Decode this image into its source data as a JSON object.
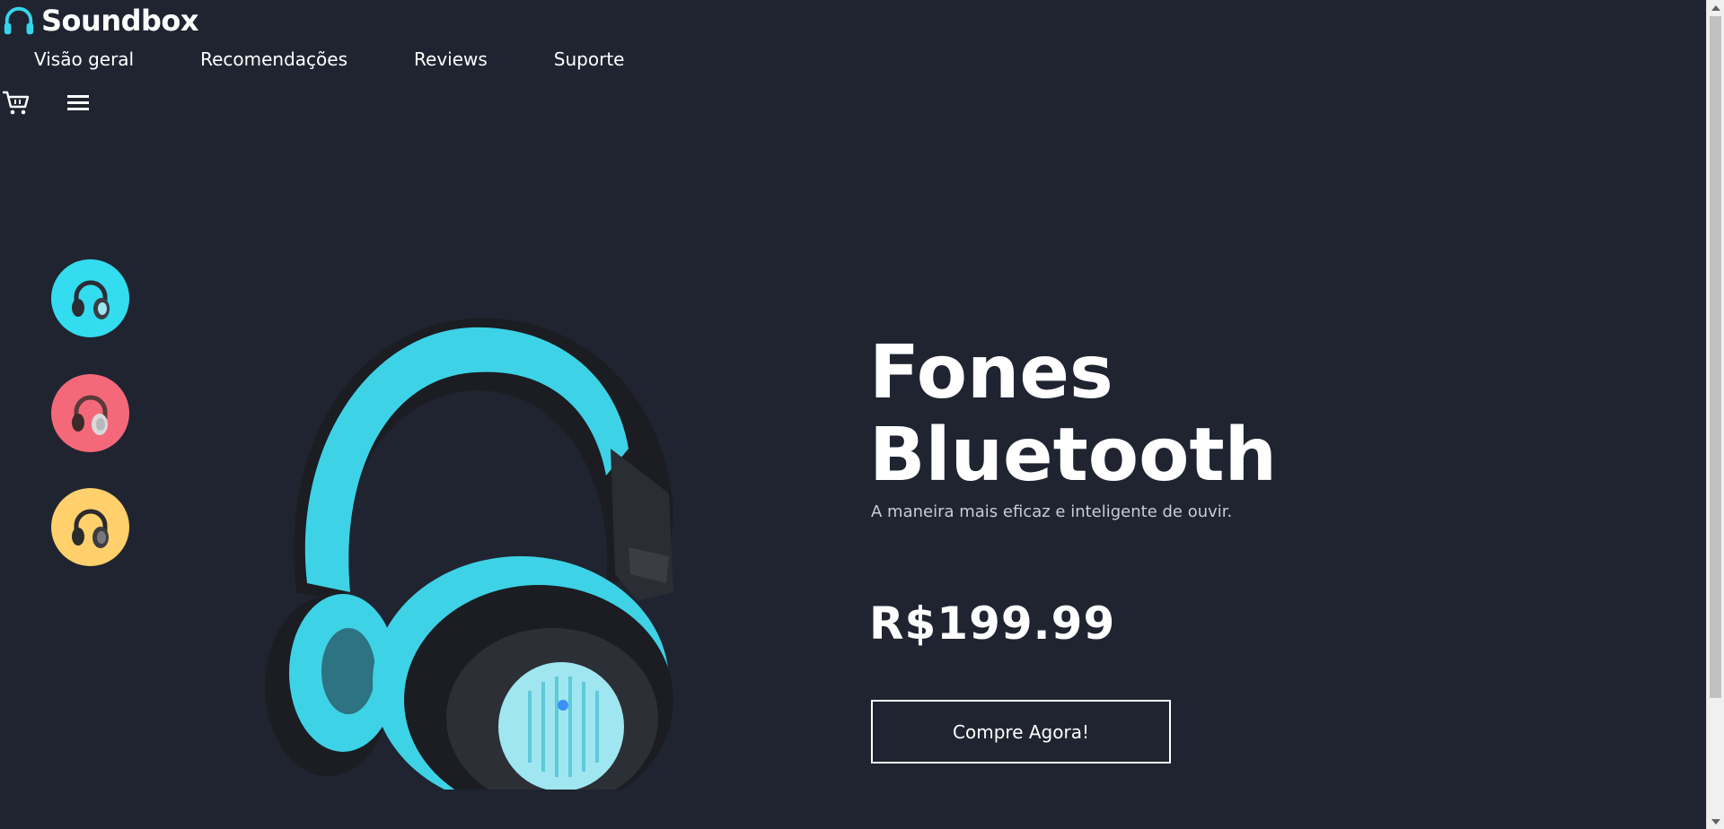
{
  "brand": {
    "name": "Soundbox",
    "icon": "headphones-icon",
    "accent": "#34d6ec"
  },
  "nav": {
    "items": [
      {
        "label": "Visão geral"
      },
      {
        "label": "Recomendações"
      },
      {
        "label": "Reviews"
      },
      {
        "label": "Suporte"
      }
    ]
  },
  "tools": {
    "cart_icon": "cart-icon",
    "menu_icon": "hamburger-menu-icon"
  },
  "swatches": [
    {
      "name": "cyan",
      "color": "#34dcf0"
    },
    {
      "name": "red",
      "color": "#f4697a"
    },
    {
      "name": "yellow",
      "color": "#ffd06b"
    }
  ],
  "product": {
    "title_line1": "Fones",
    "title_line2": "Bluetooth",
    "subtitle": "A maneira mais eficaz e inteligente de ouvir.",
    "price": "R$199.99",
    "cta": "Compre Agora!",
    "headphone_color": "#3ed2e6",
    "dark_color": "#1b1d22"
  },
  "colors": {
    "background": "#1f2430",
    "text": "#ffffff",
    "muted": "#c9ccd3"
  }
}
